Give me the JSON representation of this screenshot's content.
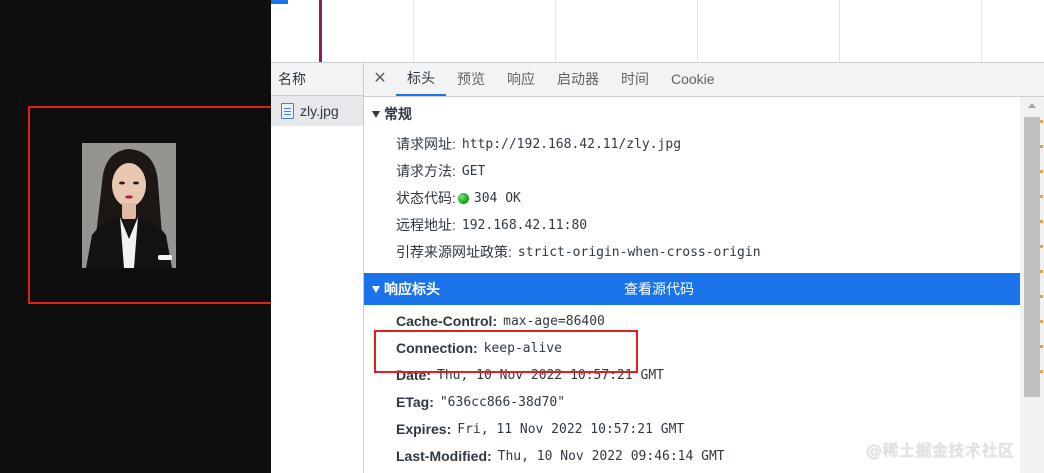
{
  "name_column": {
    "header": "名称",
    "rows": [
      {
        "name": "zly.jpg",
        "icon": "document-icon"
      }
    ]
  },
  "tabs": {
    "close": "✕",
    "items": [
      "标头",
      "预览",
      "响应",
      "启动器",
      "时间",
      "Cookie"
    ],
    "active": "标头"
  },
  "general": {
    "title": "常规",
    "rows": [
      {
        "key": "请求网址:",
        "value": "http://192.168.42.11/zly.jpg"
      },
      {
        "key": "请求方法:",
        "value": "GET"
      },
      {
        "key": "状态代码:",
        "value": "304 OK"
      },
      {
        "key": "远程地址:",
        "value": "192.168.42.11:80"
      },
      {
        "key": "引荐来源网址政策:",
        "value": "strict-origin-when-cross-origin"
      }
    ]
  },
  "response_headers": {
    "title": "响应标头",
    "view_source": "查看源代码",
    "rows": [
      {
        "key": "Cache-Control:",
        "value": "max-age=86400"
      },
      {
        "key": "Connection:",
        "value": "keep-alive"
      },
      {
        "key": "Date:",
        "value": "Thu, 10 Nov 2022 10:57:21 GMT"
      },
      {
        "key": "ETag:",
        "value": "\"636cc866-38d70\""
      },
      {
        "key": "Expires:",
        "value": "Fri, 11 Nov 2022 10:57:21 GMT"
      },
      {
        "key": "Last-Modified:",
        "value": "Thu, 10 Nov 2022 09:46:14 GMT"
      }
    ]
  },
  "watermark": "@稀土掘金技术社区",
  "colors": {
    "accent": "#1a73e8",
    "highlight": "#e02020",
    "status_ok": "#14a814"
  }
}
